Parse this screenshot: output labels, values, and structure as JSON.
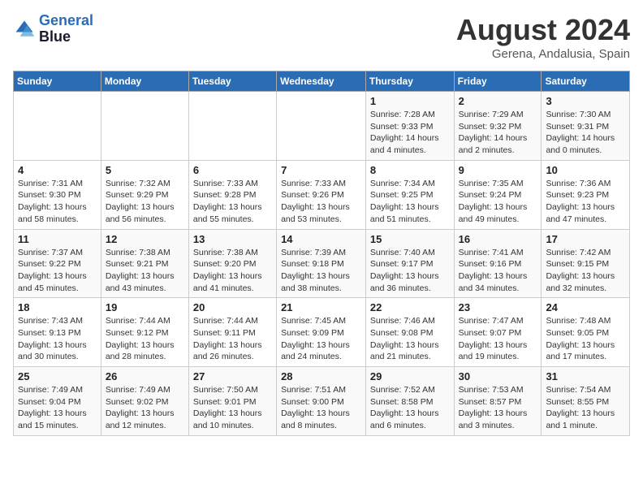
{
  "header": {
    "logo_line1": "General",
    "logo_line2": "Blue",
    "month": "August 2024",
    "location": "Gerena, Andalusia, Spain"
  },
  "weekdays": [
    "Sunday",
    "Monday",
    "Tuesday",
    "Wednesday",
    "Thursday",
    "Friday",
    "Saturday"
  ],
  "weeks": [
    [
      {
        "day": "",
        "info": ""
      },
      {
        "day": "",
        "info": ""
      },
      {
        "day": "",
        "info": ""
      },
      {
        "day": "",
        "info": ""
      },
      {
        "day": "1",
        "info": "Sunrise: 7:28 AM\nSunset: 9:33 PM\nDaylight: 14 hours\nand 4 minutes."
      },
      {
        "day": "2",
        "info": "Sunrise: 7:29 AM\nSunset: 9:32 PM\nDaylight: 14 hours\nand 2 minutes."
      },
      {
        "day": "3",
        "info": "Sunrise: 7:30 AM\nSunset: 9:31 PM\nDaylight: 14 hours\nand 0 minutes."
      }
    ],
    [
      {
        "day": "4",
        "info": "Sunrise: 7:31 AM\nSunset: 9:30 PM\nDaylight: 13 hours\nand 58 minutes."
      },
      {
        "day": "5",
        "info": "Sunrise: 7:32 AM\nSunset: 9:29 PM\nDaylight: 13 hours\nand 56 minutes."
      },
      {
        "day": "6",
        "info": "Sunrise: 7:33 AM\nSunset: 9:28 PM\nDaylight: 13 hours\nand 55 minutes."
      },
      {
        "day": "7",
        "info": "Sunrise: 7:33 AM\nSunset: 9:26 PM\nDaylight: 13 hours\nand 53 minutes."
      },
      {
        "day": "8",
        "info": "Sunrise: 7:34 AM\nSunset: 9:25 PM\nDaylight: 13 hours\nand 51 minutes."
      },
      {
        "day": "9",
        "info": "Sunrise: 7:35 AM\nSunset: 9:24 PM\nDaylight: 13 hours\nand 49 minutes."
      },
      {
        "day": "10",
        "info": "Sunrise: 7:36 AM\nSunset: 9:23 PM\nDaylight: 13 hours\nand 47 minutes."
      }
    ],
    [
      {
        "day": "11",
        "info": "Sunrise: 7:37 AM\nSunset: 9:22 PM\nDaylight: 13 hours\nand 45 minutes."
      },
      {
        "day": "12",
        "info": "Sunrise: 7:38 AM\nSunset: 9:21 PM\nDaylight: 13 hours\nand 43 minutes."
      },
      {
        "day": "13",
        "info": "Sunrise: 7:38 AM\nSunset: 9:20 PM\nDaylight: 13 hours\nand 41 minutes."
      },
      {
        "day": "14",
        "info": "Sunrise: 7:39 AM\nSunset: 9:18 PM\nDaylight: 13 hours\nand 38 minutes."
      },
      {
        "day": "15",
        "info": "Sunrise: 7:40 AM\nSunset: 9:17 PM\nDaylight: 13 hours\nand 36 minutes."
      },
      {
        "day": "16",
        "info": "Sunrise: 7:41 AM\nSunset: 9:16 PM\nDaylight: 13 hours\nand 34 minutes."
      },
      {
        "day": "17",
        "info": "Sunrise: 7:42 AM\nSunset: 9:15 PM\nDaylight: 13 hours\nand 32 minutes."
      }
    ],
    [
      {
        "day": "18",
        "info": "Sunrise: 7:43 AM\nSunset: 9:13 PM\nDaylight: 13 hours\nand 30 minutes."
      },
      {
        "day": "19",
        "info": "Sunrise: 7:44 AM\nSunset: 9:12 PM\nDaylight: 13 hours\nand 28 minutes."
      },
      {
        "day": "20",
        "info": "Sunrise: 7:44 AM\nSunset: 9:11 PM\nDaylight: 13 hours\nand 26 minutes."
      },
      {
        "day": "21",
        "info": "Sunrise: 7:45 AM\nSunset: 9:09 PM\nDaylight: 13 hours\nand 24 minutes."
      },
      {
        "day": "22",
        "info": "Sunrise: 7:46 AM\nSunset: 9:08 PM\nDaylight: 13 hours\nand 21 minutes."
      },
      {
        "day": "23",
        "info": "Sunrise: 7:47 AM\nSunset: 9:07 PM\nDaylight: 13 hours\nand 19 minutes."
      },
      {
        "day": "24",
        "info": "Sunrise: 7:48 AM\nSunset: 9:05 PM\nDaylight: 13 hours\nand 17 minutes."
      }
    ],
    [
      {
        "day": "25",
        "info": "Sunrise: 7:49 AM\nSunset: 9:04 PM\nDaylight: 13 hours\nand 15 minutes."
      },
      {
        "day": "26",
        "info": "Sunrise: 7:49 AM\nSunset: 9:02 PM\nDaylight: 13 hours\nand 12 minutes."
      },
      {
        "day": "27",
        "info": "Sunrise: 7:50 AM\nSunset: 9:01 PM\nDaylight: 13 hours\nand 10 minutes."
      },
      {
        "day": "28",
        "info": "Sunrise: 7:51 AM\nSunset: 9:00 PM\nDaylight: 13 hours\nand 8 minutes."
      },
      {
        "day": "29",
        "info": "Sunrise: 7:52 AM\nSunset: 8:58 PM\nDaylight: 13 hours\nand 6 minutes."
      },
      {
        "day": "30",
        "info": "Sunrise: 7:53 AM\nSunset: 8:57 PM\nDaylight: 13 hours\nand 3 minutes."
      },
      {
        "day": "31",
        "info": "Sunrise: 7:54 AM\nSunset: 8:55 PM\nDaylight: 13 hours\nand 1 minute."
      }
    ]
  ]
}
